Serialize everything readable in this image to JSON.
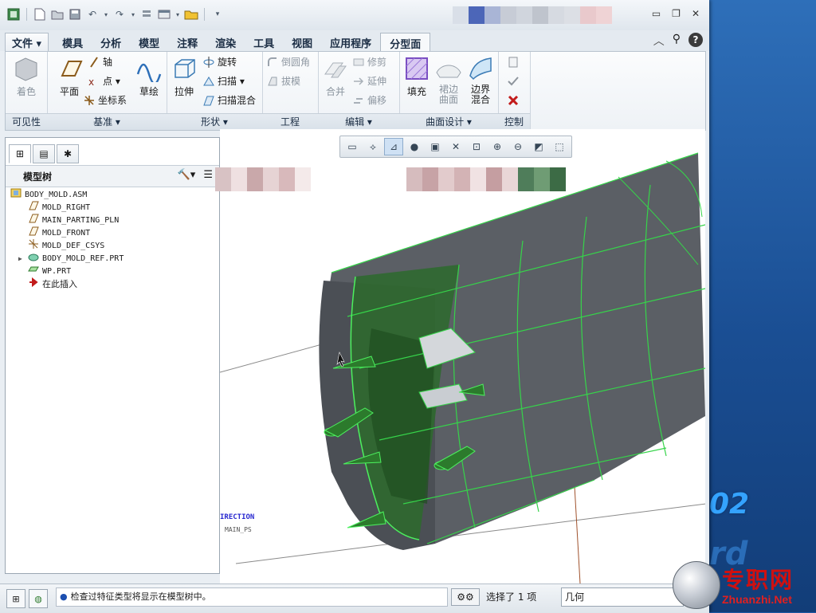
{
  "ribbon_tabs": [
    {
      "label": "文件 ▾",
      "cls": "file"
    },
    {
      "label": "模具",
      "cls": ""
    },
    {
      "label": "分析",
      "cls": ""
    },
    {
      "label": "模型",
      "cls": ""
    },
    {
      "label": "注释",
      "cls": ""
    },
    {
      "label": "渲染",
      "cls": ""
    },
    {
      "label": "工具",
      "cls": ""
    },
    {
      "label": "视图",
      "cls": ""
    },
    {
      "label": "应用程序",
      "cls": ""
    },
    {
      "label": "分型面",
      "cls": "active"
    }
  ],
  "ribbon": {
    "visibility": {
      "label": "可见性",
      "shade": "着色"
    },
    "datum": {
      "label": "基准 ▾",
      "plane": "平面",
      "axis": "轴",
      "point": "点 ▾",
      "csys": "坐标系",
      "sketch": "草绘"
    },
    "shapes": {
      "label": "形状 ▾",
      "extrude": "拉伸",
      "revolve": "旋转",
      "sweep": "扫描 ▾",
      "swept_blend": "扫描混合"
    },
    "engineering": {
      "label": "工程",
      "round": "倒圆角",
      "draft": "拔模"
    },
    "editing": {
      "label": "编辑 ▾",
      "merge": "合并",
      "trim": "修剪",
      "extend": "延伸",
      "offset": "偏移"
    },
    "surface_design": {
      "label": "曲面设计 ▾",
      "fill": "填充",
      "skirt": "裙边曲面",
      "boundary_blend": "边界混合"
    },
    "control": {
      "label": "控制"
    }
  },
  "model_tree": {
    "title": "模型树",
    "items": [
      {
        "label": "BODY_MOLD.ASM",
        "icon": "assembly-icon",
        "level": 0
      },
      {
        "label": "MOLD_RIGHT",
        "icon": "datum-plane-icon",
        "level": 1
      },
      {
        "label": "MAIN_PARTING_PLN",
        "icon": "datum-plane-icon",
        "level": 1
      },
      {
        "label": "MOLD_FRONT",
        "icon": "datum-plane-icon",
        "level": 1
      },
      {
        "label": "MOLD_DEF_CSYS",
        "icon": "csys-icon",
        "level": 1
      },
      {
        "label": "BODY_MOLD_REF.PRT",
        "icon": "part-icon",
        "level": 1,
        "expandable": true
      },
      {
        "label": "WP.PRT",
        "icon": "workpiece-icon",
        "level": 1
      },
      {
        "label": "在此插入",
        "icon": "insert-here-icon",
        "level": 1
      }
    ]
  },
  "viewport": {
    "direction_label": "IRECTION",
    "csys_label": "MAIN_PS"
  },
  "status": {
    "message": "检查过特征类型将显示在模型树中。",
    "selection": "选择了 1 项",
    "filter": "几何"
  },
  "watermark": {
    "cn": "专职网",
    "en": "Zhuanzhi.Net"
  },
  "desktop_text": "02"
}
